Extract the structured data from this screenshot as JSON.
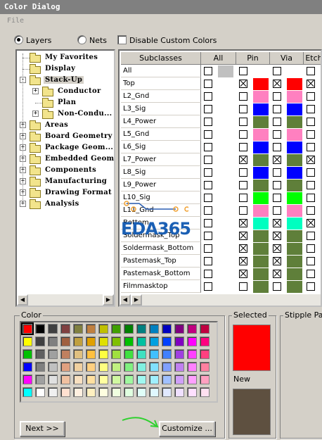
{
  "window": {
    "title": "Color Dialog"
  },
  "menu": {
    "file": "File"
  },
  "options": {
    "layers": "Layers",
    "nets": "Nets",
    "disable_custom": "Disable Custom Colors"
  },
  "tree": {
    "items": [
      {
        "label": "My Favorites",
        "level": 0,
        "expander": ""
      },
      {
        "label": "Display",
        "level": 0,
        "expander": ""
      },
      {
        "label": "Stack-Up",
        "level": 0,
        "expander": "-"
      },
      {
        "label": "Conductor",
        "level": 1,
        "expander": "+"
      },
      {
        "label": "Plan",
        "level": 1,
        "expander": ""
      },
      {
        "label": "Non-Condu...",
        "level": 1,
        "expander": "+"
      },
      {
        "label": "Areas",
        "level": 0,
        "expander": "+"
      },
      {
        "label": "Board Geometry",
        "level": 0,
        "expander": "+"
      },
      {
        "label": "Package Geom...",
        "level": 0,
        "expander": "+"
      },
      {
        "label": "Embedded Geom...",
        "level": 0,
        "expander": "+"
      },
      {
        "label": "Components",
        "level": 0,
        "expander": "+"
      },
      {
        "label": "Manufacturing",
        "level": 0,
        "expander": "+"
      },
      {
        "label": "Drawing Format",
        "level": 0,
        "expander": "+"
      },
      {
        "label": "Analysis",
        "level": 0,
        "expander": "+"
      }
    ]
  },
  "grid": {
    "headers": [
      "Subclasses",
      "All",
      "Pin",
      "Via",
      "Etch"
    ],
    "rows": [
      {
        "name": "All",
        "all": [
          0,
          "#c0c0c0"
        ],
        "pin": [
          0,
          "#ffffff"
        ],
        "via": [
          0,
          "#ffffff"
        ],
        "etch": [
          0,
          "#ffffff"
        ]
      },
      {
        "name": "Top",
        "all": [
          0,
          ""
        ],
        "pin": [
          1,
          "#ff0000"
        ],
        "via": [
          1,
          "#ff0000"
        ],
        "etch": [
          1,
          "#ff0000"
        ]
      },
      {
        "name": "L2_Gnd",
        "all": [
          0,
          ""
        ],
        "pin": [
          0,
          "#ff80c0"
        ],
        "via": [
          0,
          "#ff80c0"
        ],
        "etch": [
          0,
          "#ff80c0"
        ]
      },
      {
        "name": "L3_Sig",
        "all": [
          0,
          ""
        ],
        "pin": [
          0,
          "#0000ff"
        ],
        "via": [
          0,
          "#0000ff"
        ],
        "etch": [
          0,
          "#ffff00"
        ]
      },
      {
        "name": "L4_Power",
        "all": [
          0,
          ""
        ],
        "pin": [
          0,
          "#5f7f3a"
        ],
        "via": [
          0,
          "#5f7f3a"
        ],
        "etch": [
          0,
          "#5f7f3a"
        ]
      },
      {
        "name": "L5_Gnd",
        "all": [
          0,
          ""
        ],
        "pin": [
          0,
          "#ff80c0"
        ],
        "via": [
          0,
          "#ff80c0"
        ],
        "etch": [
          0,
          "#ff80c0"
        ]
      },
      {
        "name": "L6_Sig",
        "all": [
          0,
          ""
        ],
        "pin": [
          0,
          "#0000ff"
        ],
        "via": [
          0,
          "#0000ff"
        ],
        "etch": [
          0,
          "#ff00ff"
        ]
      },
      {
        "name": "L7_Power",
        "all": [
          0,
          ""
        ],
        "pin": [
          1,
          "#5f7f3a"
        ],
        "via": [
          1,
          "#5f7f3a"
        ],
        "etch": [
          1,
          "#5f7f3a"
        ]
      },
      {
        "name": "L8_Sig",
        "all": [
          0,
          ""
        ],
        "pin": [
          0,
          "#0000ff"
        ],
        "via": [
          0,
          "#0000ff"
        ],
        "etch": [
          0,
          "#ff8000"
        ]
      },
      {
        "name": "L9_Power",
        "all": [
          0,
          ""
        ],
        "pin": [
          0,
          "#5f7f3a"
        ],
        "via": [
          0,
          "#5f7f3a"
        ],
        "etch": [
          0,
          "#5f7f3a"
        ]
      },
      {
        "name": "L10_Sig",
        "all": [
          0,
          ""
        ],
        "pin": [
          0,
          "#00ff00"
        ],
        "via": [
          0,
          "#00ff00"
        ],
        "etch": [
          0,
          "#00ff00"
        ]
      },
      {
        "name": "L11_Gnd",
        "all": [
          0,
          ""
        ],
        "pin": [
          0,
          "#ff80c0"
        ],
        "via": [
          0,
          "#ff80c0"
        ],
        "etch": [
          0,
          "#ff80c0"
        ]
      },
      {
        "name": "Bottom",
        "all": [
          0,
          ""
        ],
        "pin": [
          1,
          "#00ffc0"
        ],
        "via": [
          1,
          "#00ffc0"
        ],
        "etch": [
          1,
          "#00ffc0"
        ]
      },
      {
        "name": "Soldermask_Top",
        "all": [
          0,
          ""
        ],
        "pin": [
          1,
          "#5f7f3a"
        ],
        "via": [
          1,
          "#5f7f3a"
        ],
        "etch": [
          0,
          ""
        ]
      },
      {
        "name": "Soldermask_Bottom",
        "all": [
          0,
          ""
        ],
        "pin": [
          1,
          "#5f7f3a"
        ],
        "via": [
          1,
          "#5f7f3a"
        ],
        "etch": [
          0,
          ""
        ]
      },
      {
        "name": "Pastemask_Top",
        "all": [
          0,
          ""
        ],
        "pin": [
          1,
          "#5f7f3a"
        ],
        "via": [
          1,
          "#5f7f3a"
        ],
        "etch": [
          0,
          ""
        ]
      },
      {
        "name": "Pastemask_Bottom",
        "all": [
          0,
          ""
        ],
        "pin": [
          1,
          "#5f7f3a"
        ],
        "via": [
          1,
          "#5f7f3a"
        ],
        "etch": [
          0,
          ""
        ]
      },
      {
        "name": "Filmmasktop",
        "all": [
          0,
          ""
        ],
        "pin": [
          0,
          "#5f7f3a"
        ],
        "via": [
          0,
          "#5f7f3a"
        ],
        "etch": [
          0,
          ""
        ]
      }
    ]
  },
  "color_panel": {
    "label": "Color",
    "palette": [
      [
        "#ff0000",
        "#000000",
        "#404040",
        "#804040",
        "#808040",
        "#c08040",
        "#c0c000",
        "#40a000",
        "#008000",
        "#008080",
        "#0080c0",
        "#0000c0",
        "#800080",
        "#c00080",
        "#c00040"
      ],
      [
        "#ffff00",
        "#404040",
        "#808080",
        "#a06040",
        "#c0a040",
        "#e0a000",
        "#e0e000",
        "#80c000",
        "#00c000",
        "#00c0a0",
        "#00a0e0",
        "#0040ff",
        "#8000c0",
        "#ff00ff",
        "#ff0080"
      ],
      [
        "#00c000",
        "#606060",
        "#a0a0a0",
        "#c08060",
        "#e0c080",
        "#ffc040",
        "#ffff40",
        "#a0e040",
        "#40e040",
        "#40e0c0",
        "#40c0ff",
        "#4080ff",
        "#a040e0",
        "#ff40ff",
        "#ff4080"
      ],
      [
        "#0000ff",
        "#808080",
        "#c0c0c0",
        "#e0a080",
        "#f0d0a0",
        "#ffd080",
        "#ffff80",
        "#c0f080",
        "#80f080",
        "#80f0e0",
        "#80e0ff",
        "#80a0ff",
        "#c080f0",
        "#ff80ff",
        "#ff80a0"
      ],
      [
        "#ff00ff",
        "#a0a0a0",
        "#e0e0e0",
        "#f0c0a0",
        "#f8e0c0",
        "#ffe0a0",
        "#ffffa0",
        "#d0f8a0",
        "#a0f8a0",
        "#a0f8f0",
        "#a0f0ff",
        "#a0c0ff",
        "#d0a0f8",
        "#ffa0ff",
        "#ffa0c0"
      ],
      [
        "#00ffff",
        "#ffffff",
        "#f0f0f0",
        "#ffe0d0",
        "#fff0e0",
        "#fff0c0",
        "#ffffe0",
        "#f0ffe0",
        "#e0ffe0",
        "#e0fff8",
        "#e0f8ff",
        "#e0e8ff",
        "#f0e0ff",
        "#ffe0ff",
        "#ffe0f0"
      ]
    ],
    "next_button": "Next >>",
    "customize_button": "Customize ..."
  },
  "selected": {
    "label": "Selected",
    "color": "#ff0000"
  },
  "new": {
    "label": "New",
    "color": "#5e5040"
  },
  "stipple": {
    "label": "Stipple Patt"
  },
  "watermark": {
    "text": "EDA365"
  }
}
